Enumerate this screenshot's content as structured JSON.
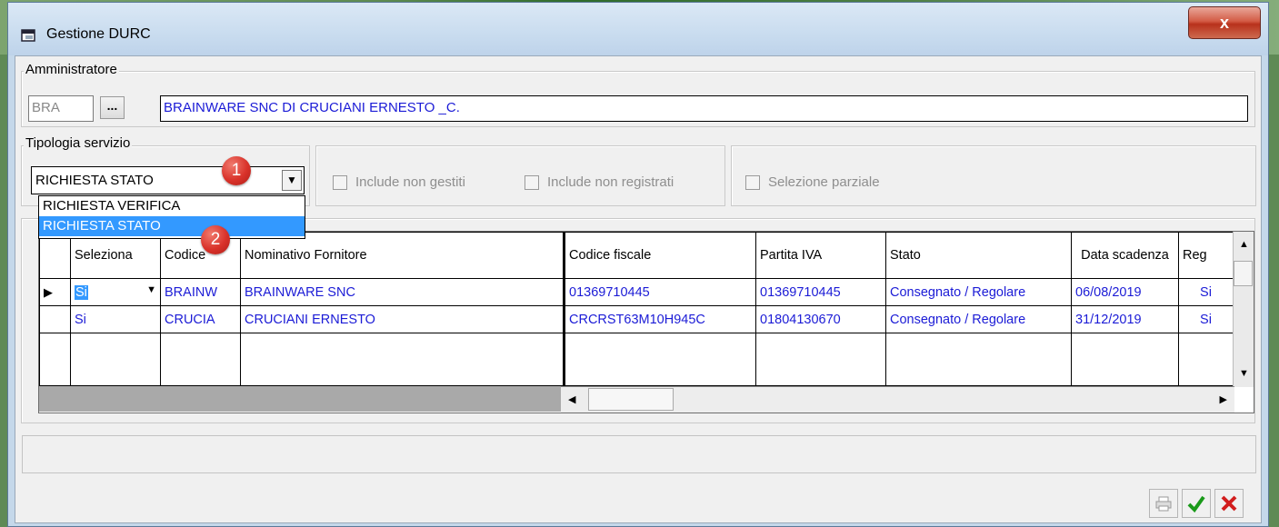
{
  "window": {
    "title": "Gestione DURC",
    "close_label": "x"
  },
  "amministratore": {
    "legend": "Amministratore",
    "code": "BRA",
    "lookup_label": "...",
    "name": "BRAINWARE SNC DI CRUCIANI ERNESTO _C."
  },
  "tipologia": {
    "legend": "Tipologia servizio",
    "selected": "RICHIESTA STATO",
    "options": [
      "RICHIESTA VERIFICA",
      "RICHIESTA STATO"
    ],
    "checks": {
      "include_non_gestiti": "Include non gestiti",
      "include_non_registrati": "Include non registrati",
      "selezione_parziale": "Selezione parziale"
    }
  },
  "badges": {
    "one": "1",
    "two": "2"
  },
  "grid": {
    "headers": [
      "Seleziona",
      "Codice",
      "Nominativo Fornitore",
      "Codice fiscale",
      "Partita IVA",
      "Stato",
      "Data scadenza",
      "Reg"
    ],
    "rows": [
      {
        "seleziona": "Si",
        "codice": "BRAINW",
        "nominativo": "BRAINWARE SNC",
        "cf": "01369710445",
        "piva": "01369710445",
        "stato": "Consegnato / Regolare",
        "scadenza": "06/08/2019",
        "reg": "Si"
      },
      {
        "seleziona": "Si",
        "codice": "CRUCIA",
        "nominativo": "CRUCIANI ERNESTO",
        "cf": "CRCRST63M10H945C",
        "piva": "01804130670",
        "stato": "Consegnato / Regolare",
        "scadenza": "31/12/2019",
        "reg": "Si"
      }
    ]
  },
  "colors": {
    "link_text": "#1b1bd6",
    "selection": "#3399ff",
    "confirm": "#1a9a1a",
    "cancel": "#d21d1d"
  },
  "icons": {
    "print": "printer-icon",
    "confirm": "checkmark-icon",
    "cancel": "x-icon"
  }
}
